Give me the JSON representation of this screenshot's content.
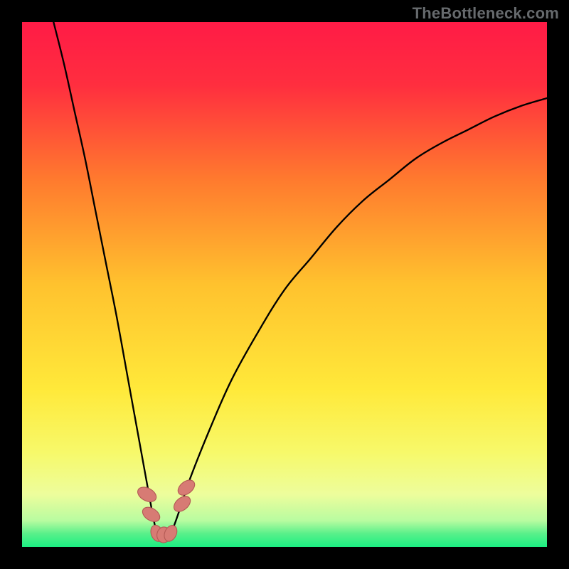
{
  "watermark": "TheBottleneck.com",
  "colors": {
    "background": "#000000",
    "gradient_stops": [
      {
        "pos": 0.0,
        "color": "#ff1b46"
      },
      {
        "pos": 0.12,
        "color": "#ff2e3f"
      },
      {
        "pos": 0.3,
        "color": "#ff7a2e"
      },
      {
        "pos": 0.5,
        "color": "#ffc22e"
      },
      {
        "pos": 0.7,
        "color": "#ffe93a"
      },
      {
        "pos": 0.82,
        "color": "#f7f96a"
      },
      {
        "pos": 0.9,
        "color": "#edfd9c"
      },
      {
        "pos": 0.95,
        "color": "#b8fca0"
      },
      {
        "pos": 0.975,
        "color": "#58f08a"
      },
      {
        "pos": 1.0,
        "color": "#1bef82"
      }
    ],
    "curve_stroke": "#000000",
    "marker_fill": "#d77b74",
    "marker_stroke": "#b35a55"
  },
  "chart_data": {
    "type": "line",
    "title": "",
    "xlabel": "",
    "ylabel": "",
    "xlim": [
      0,
      100
    ],
    "ylim": [
      0,
      100
    ],
    "series": [
      {
        "name": "bottleneck-curve",
        "x": [
          6,
          8,
          10,
          12,
          14,
          16,
          18,
          20,
          22,
          24,
          25.7,
          27,
          28.3,
          30,
          32,
          36,
          40,
          45,
          50,
          55,
          60,
          65,
          70,
          75,
          80,
          85,
          90,
          95,
          100
        ],
        "y": [
          100,
          92,
          83,
          74,
          64,
          54,
          44,
          33,
          22,
          11,
          2.6,
          2.3,
          2.6,
          7,
          13,
          23,
          32,
          41,
          49,
          55,
          61,
          66,
          70,
          74,
          77,
          79.5,
          82,
          84,
          85.5
        ]
      }
    ],
    "markers": [
      {
        "x": 23.8,
        "y": 10,
        "w": 2.4,
        "h": 3.8,
        "angle": -62
      },
      {
        "x": 24.6,
        "y": 6.2,
        "w": 2.3,
        "h": 3.6,
        "angle": -58
      },
      {
        "x": 25.7,
        "y": 2.6,
        "w": 2.2,
        "h": 3.2,
        "angle": -20
      },
      {
        "x": 27.0,
        "y": 2.3,
        "w": 2.6,
        "h": 3.0,
        "angle": 8
      },
      {
        "x": 28.3,
        "y": 2.6,
        "w": 2.2,
        "h": 3.2,
        "angle": 25
      },
      {
        "x": 30.5,
        "y": 8.2,
        "w": 2.3,
        "h": 3.6,
        "angle": 50
      },
      {
        "x": 31.3,
        "y": 11.3,
        "w": 2.3,
        "h": 3.6,
        "angle": 52
      }
    ]
  }
}
